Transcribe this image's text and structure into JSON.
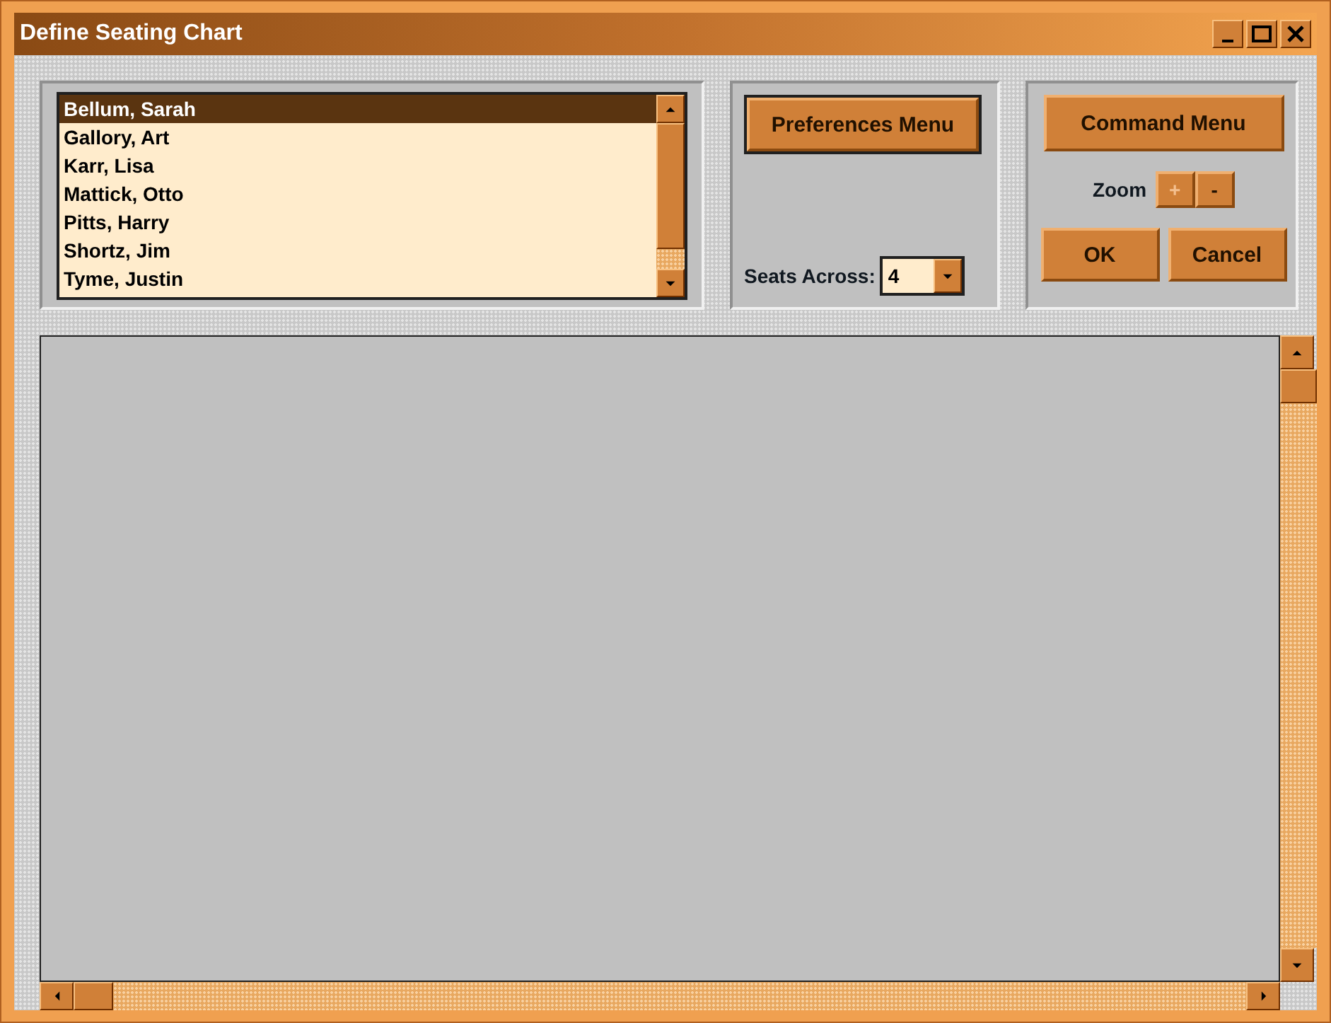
{
  "window": {
    "title": "Define Seating Chart"
  },
  "students": [
    {
      "name": "Bellum, Sarah",
      "selected": true
    },
    {
      "name": "Gallory, Art",
      "selected": false
    },
    {
      "name": "Karr, Lisa",
      "selected": false
    },
    {
      "name": "Mattick, Otto",
      "selected": false
    },
    {
      "name": "Pitts, Harry",
      "selected": false
    },
    {
      "name": "Shortz, Jim",
      "selected": false
    },
    {
      "name": "Tyme, Justin",
      "selected": false
    }
  ],
  "preferences_button": {
    "label": "Preferences Menu",
    "focused": true
  },
  "seats_across": {
    "label": "Seats Across:",
    "value": "4"
  },
  "command_button": {
    "label": "Command Menu",
    "focused": false
  },
  "zoom": {
    "label": "Zoom",
    "buttons": [
      {
        "label": "+",
        "disabled": true
      },
      {
        "label": "-",
        "disabled": false
      }
    ]
  },
  "dialog_buttons": [
    {
      "label": "OK"
    },
    {
      "label": "Cancel"
    }
  ]
}
